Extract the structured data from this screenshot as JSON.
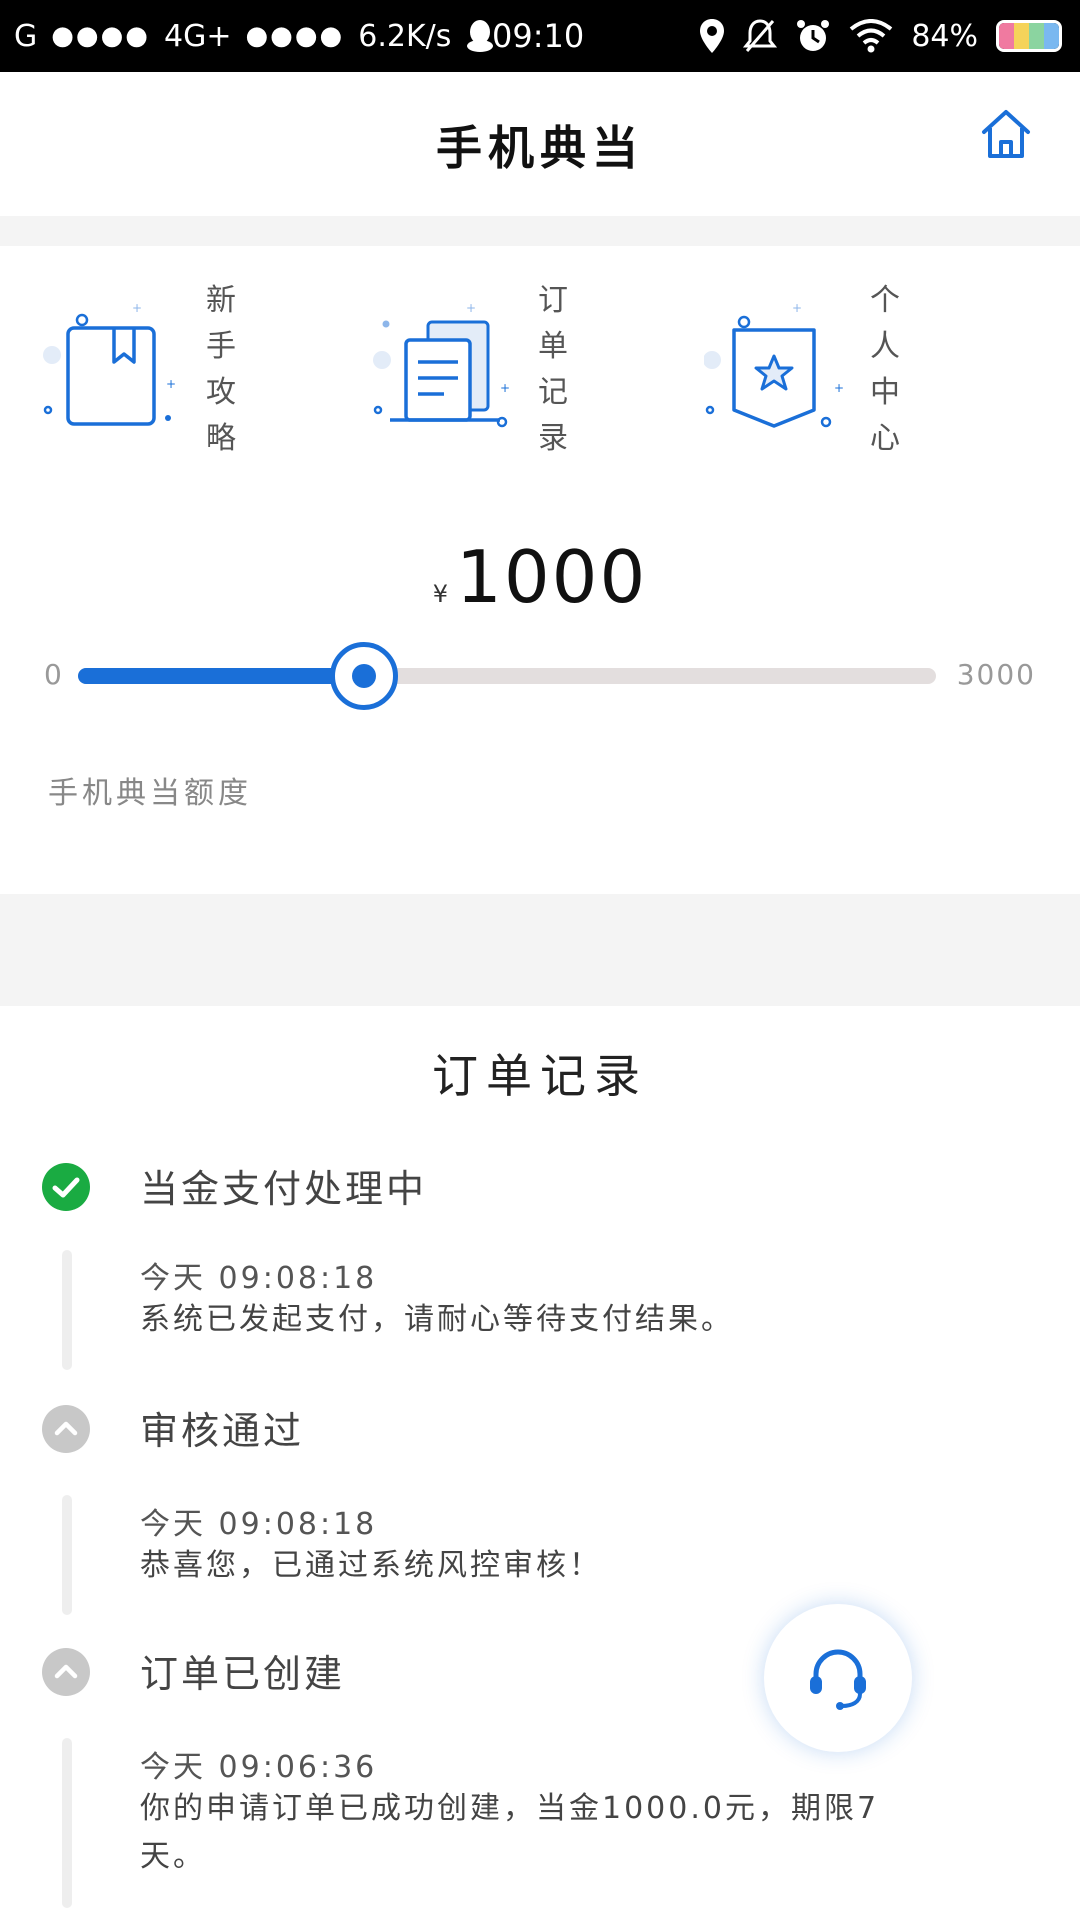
{
  "status_bar": {
    "carrier": "G",
    "signal1": "●●●●",
    "network": "4G+",
    "signal2": "●●●●",
    "speed": "6.2K/s",
    "time": "09:10",
    "battery": "84%"
  },
  "header": {
    "title": "手机典当"
  },
  "shortcuts": [
    {
      "label": "新手攻略",
      "icon": "guide-book-icon"
    },
    {
      "label": "订单记录",
      "icon": "order-docs-icon"
    },
    {
      "label": "个人中心",
      "icon": "profile-badge-icon"
    }
  ],
  "amount": {
    "currency": "¥",
    "value": "1000"
  },
  "slider": {
    "min": "0",
    "max": "3000",
    "value": 1000
  },
  "quota_label": "手机典当额度",
  "orders": {
    "title": "订单记录",
    "steps": [
      {
        "title": "当金支付处理中",
        "time": "今天 09:08:18",
        "message": "系统已发起支付，请耐心等待支付结果。",
        "status": "done"
      },
      {
        "title": "审核通过",
        "time": "今天 09:08:18",
        "message": "恭喜您，已通过系统风控审核！",
        "status": "past"
      },
      {
        "title": "订单已创建",
        "time": "今天 09:06:36",
        "message": "你的申请订单已成功创建，当金1000.0元，期限7天。",
        "status": "past"
      }
    ]
  },
  "colors": {
    "accent": "#1a6fd8",
    "success": "#1aab42",
    "inactive": "#c8c8c8",
    "section_gap": "#f4f4f4"
  }
}
